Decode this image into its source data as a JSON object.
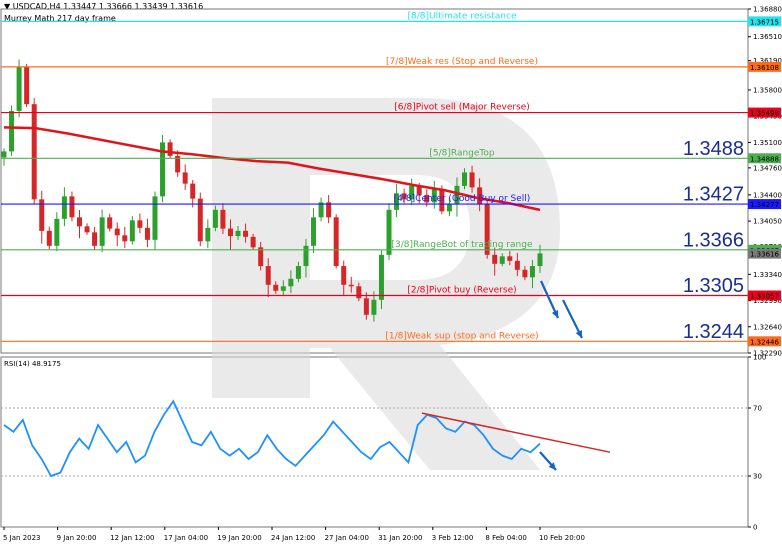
{
  "header": {
    "symbol_line": "USDCAD,H4  1.33447 1.33666 1.33439 1.33616",
    "indicator_line": "Murrey Math 217 day frame"
  },
  "colors": {
    "bull": "#2ca02c",
    "bear": "#d62728",
    "ma": "#e0141c",
    "rsi": "#1e90ff",
    "arrow": "#1565c0",
    "watermark": "#d9d9d9"
  },
  "chart_data": [
    {
      "type": "candlestick",
      "symbol": "USDCAD",
      "timeframe": "H4",
      "ohlc_last": {
        "open": 1.33447,
        "high": 1.33666,
        "low": 1.33439,
        "close": 1.33616
      },
      "ylim": [
        1.3229,
        1.3688
      ],
      "y_ticks": [
        "1.36880",
        "1.36510",
        "1.36190",
        "1.35800",
        "1.35450",
        "1.35100",
        "1.34760",
        "1.34400",
        "1.34050",
        "1.33710",
        "1.33340",
        "1.32990",
        "1.32640",
        "1.32290"
      ],
      "x_ticks": [
        "5 Jan 2023",
        "9 Jan 20:00",
        "12 Jan 12:00",
        "17 Jan 04:00",
        "19 Jan 20:00",
        "24 Jan 12:00",
        "27 Jan 04:00",
        "31 Jan 20:00",
        "3 Feb 12:00",
        "8 Feb 04:00",
        "10 Feb 20:00"
      ],
      "close_path": [
        1.3498,
        1.3552,
        1.361,
        1.3561,
        1.3434,
        1.3392,
        1.3372,
        1.3408,
        1.3438,
        1.341,
        1.3398,
        1.339,
        1.3372,
        1.341,
        1.3395,
        1.3386,
        1.3378,
        1.3406,
        1.3396,
        1.338,
        1.3438,
        1.351,
        1.3492,
        1.347,
        1.3455,
        1.3435,
        1.3378,
        1.3396,
        1.342,
        1.3395,
        1.3385,
        1.3392,
        1.3384,
        1.337,
        1.3345,
        1.332,
        1.3312,
        1.3318,
        1.3328,
        1.3345,
        1.3372,
        1.341,
        1.343,
        1.341,
        1.3345,
        1.332,
        1.3318,
        1.3302,
        1.328,
        1.33,
        1.336,
        1.342,
        1.3442,
        1.3434,
        1.3452,
        1.344,
        1.343,
        1.3448,
        1.3418,
        1.3428,
        1.3452,
        1.347,
        1.345,
        1.3428,
        1.336,
        1.3348,
        1.3358,
        1.3352,
        1.334,
        1.333,
        1.3345,
        1.3362
      ],
      "moving_average": {
        "values": [
          1.353,
          1.3529,
          1.3522,
          1.3514,
          1.3506,
          1.3498,
          1.3494,
          1.3489,
          1.3485,
          1.3483,
          1.3475,
          1.3468,
          1.3461,
          1.3453,
          1.3446,
          1.3436,
          1.3429,
          1.342
        ]
      },
      "murrey_levels": [
        {
          "label": "[8/8]Ultimate resistance",
          "value": 1.36715,
          "tag": "1.36715",
          "color": "#22e3ee"
        },
        {
          "label": "[7/8]Weak res (Stop and Reverse)",
          "value": 1.36108,
          "tag": "1.36108",
          "color": "#ff6a1a"
        },
        {
          "label": "[6/8]Pivot sell (Major Reverse)",
          "value": 1.35498,
          "tag": "1.35498",
          "color": "#e8001c"
        },
        {
          "label": "[5/8]RangeTop",
          "value": 1.34888,
          "tag": "1.34888",
          "color": "#4caf50"
        },
        {
          "label": "[4/8]Center (Good Buy or Sell)",
          "value": 1.34277,
          "tag": "1.34277",
          "color": "#1a1aff"
        },
        {
          "label": "[3/8]RangeBot of trading range",
          "value": 1.33667,
          "tag": "1.33667",
          "color": "#4caf50"
        },
        {
          "label": "[2/8]Pivot buy (Reverse)",
          "value": 1.33057,
          "tag": "1.33057",
          "color": "#e8001c"
        },
        {
          "label": "[1/8]Weak sup (stop and Reverse)",
          "value": 1.32446,
          "tag": "1.32446",
          "color": "#ff6a1a"
        }
      ],
      "price_tag_current": {
        "value": 1.33616,
        "tag": "1.33616"
      },
      "big_levels": [
        {
          "text": "1.3488",
          "value": 1.3488
        },
        {
          "text": "1.3427",
          "value": 1.3427
        },
        {
          "text": "1.3366",
          "value": 1.3366
        },
        {
          "text": "1.3305",
          "value": 1.3305
        },
        {
          "text": "1.3244",
          "value": 1.3244
        }
      ]
    },
    {
      "type": "line",
      "title": "RSI(14) 48.9175",
      "ylim": [
        0,
        100
      ],
      "y_ticks": [
        "100",
        "70",
        "30",
        "0"
      ],
      "levels": [
        70,
        30
      ],
      "values": [
        60,
        56,
        63,
        48,
        40,
        30,
        32,
        44,
        52,
        46,
        60,
        52,
        44,
        50,
        38,
        42,
        56,
        66,
        74,
        62,
        50,
        48,
        56,
        46,
        42,
        46,
        40,
        44,
        54,
        46,
        40,
        36,
        42,
        48,
        54,
        62,
        56,
        50,
        44,
        40,
        47,
        50,
        44,
        38,
        60,
        66,
        64,
        58,
        56,
        62,
        60,
        54,
        46,
        42,
        40,
        46,
        44,
        49
      ],
      "trendline": {
        "from": 67,
        "to": 44
      }
    }
  ]
}
